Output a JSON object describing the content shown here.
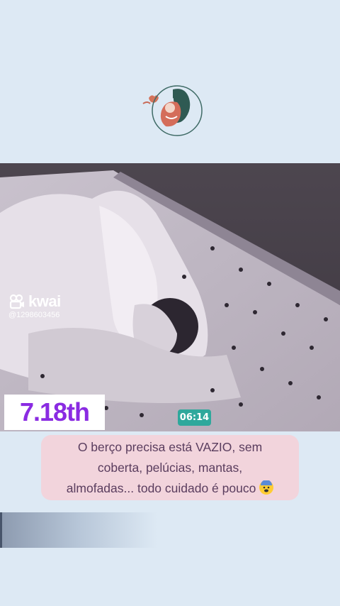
{
  "watermark": {
    "brand": "kwai",
    "handle": "@1298603456"
  },
  "rank_badge": {
    "label": "7.18th",
    "color": "#8a2be2"
  },
  "video_timer": "06:14",
  "caption": {
    "line1": "O berço precisa está VAZIO, sem",
    "line2": "coberta, pelúcias, mantas,",
    "line3": "almofadas... todo cuidado é pouco",
    "emoji": "anxious-face-icon"
  },
  "colors": {
    "background": "#dde9f4",
    "caption_bg": "#f2d4dc",
    "timer_bg": "#2fa89c"
  }
}
